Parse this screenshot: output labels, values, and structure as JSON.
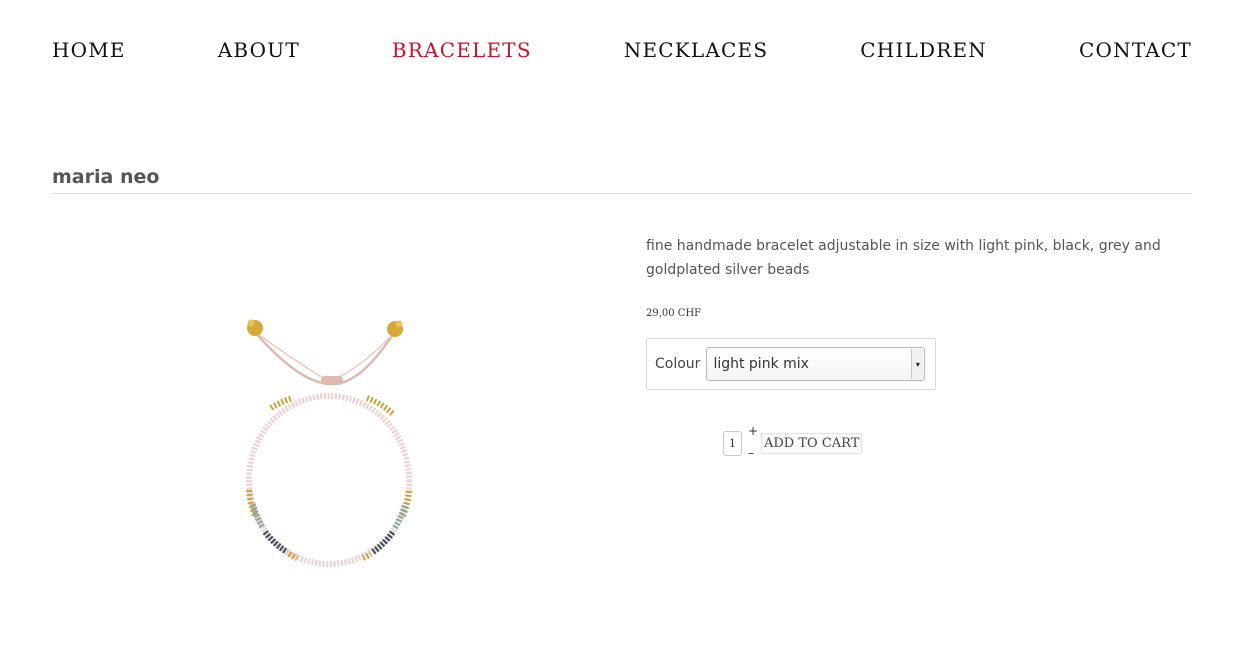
{
  "nav": {
    "items": [
      {
        "label": "HOME"
      },
      {
        "label": "ABOUT"
      },
      {
        "label": "BRACELETS"
      },
      {
        "label": "NECKLACES"
      },
      {
        "label": "CHILDREN"
      },
      {
        "label": "CONTACT"
      }
    ],
    "active_color": "#c2152b"
  },
  "product": {
    "title": "maria neo",
    "description": "fine handmade bracelet adjustable in size with light pink, black, grey and goldplated silver beads",
    "price": "29,00 CHF",
    "variant_label": "Colour",
    "variant_selected": "light pink mix",
    "quantity": "1",
    "qty_plus": "+",
    "qty_minus": "–",
    "add_to_cart": "ADD TO CART"
  }
}
